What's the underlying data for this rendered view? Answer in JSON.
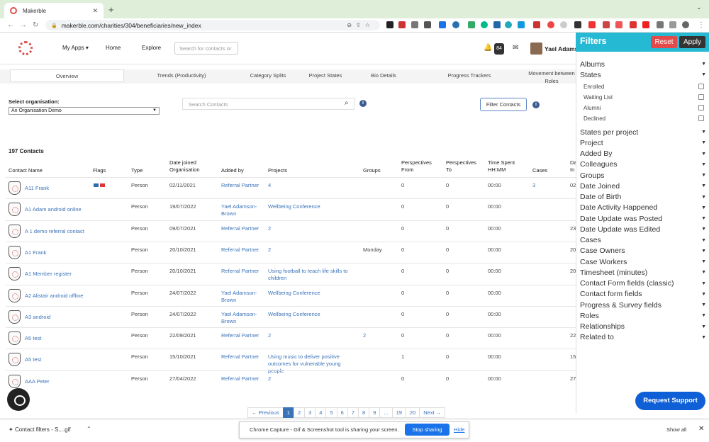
{
  "browser": {
    "tab_title": "Makerble",
    "url": "makerble.com/charities/304/beneficiaries/new_index"
  },
  "header": {
    "my_apps": "My Apps ▾",
    "home": "Home",
    "explore": "Explore",
    "search_placeholder": "Search for contacts or",
    "notifications_count": "84",
    "user_name": "Yael Adams"
  },
  "tabs": [
    "Overview",
    "Trends (Productivity)",
    "Category Splits",
    "Project States",
    "Bio Details",
    "Progress Trackers",
    "Movement between Roles"
  ],
  "org": {
    "label": "Select organisation:",
    "selected": "An Organisation Demo"
  },
  "search": {
    "placeholder": "Search Contacts",
    "filter_button": "Filter Contacts"
  },
  "table": {
    "count_label": "197 Contacts",
    "headers": [
      "Contact Name",
      "Flags",
      "Type",
      "Date joined Organisation",
      "Added by",
      "Projects",
      "Groups",
      "Perspectives From",
      "Perspectives To",
      "Time Spent HH:MM",
      "Cases",
      "Da In"
    ],
    "rows": [
      {
        "name": "A11 Frank",
        "flags": "flags",
        "type": "Person",
        "date": "02/11/2021",
        "added_by": "Referral Partner",
        "projects": "4",
        "groups": "",
        "from": "0",
        "to": "0",
        "time": "00:00",
        "cases": "3",
        "extra": "02"
      },
      {
        "name": "A1 Adam android online",
        "flags": "",
        "type": "Person",
        "date": "19/07/2022",
        "added_by": "Yael Adamson-Brown",
        "projects": "Wellbeing Conference",
        "groups": "",
        "from": "0",
        "to": "0",
        "time": "00:00",
        "cases": "",
        "extra": ""
      },
      {
        "name": "A 1 demo referral contact",
        "flags": "",
        "type": "Person",
        "date": "09/07/2021",
        "added_by": "Referral Partner",
        "projects": "2",
        "groups": "",
        "from": "0",
        "to": "0",
        "time": "00:00",
        "cases": "",
        "extra": "23"
      },
      {
        "name": "A1 Frank",
        "flags": "",
        "type": "Person",
        "date": "20/10/2021",
        "added_by": "Referral Partner",
        "projects": "2",
        "groups": "Monday",
        "from": "0",
        "to": "0",
        "time": "00:00",
        "cases": "",
        "extra": "20"
      },
      {
        "name": "A1 Member register",
        "flags": "",
        "type": "Person",
        "date": "20/10/2021",
        "added_by": "Referral Partner",
        "projects": "Using football to teach life skills to children",
        "groups": "",
        "from": "0",
        "to": "0",
        "time": "00:00",
        "cases": "",
        "extra": "20"
      },
      {
        "name": "A2 Alistair android offline",
        "flags": "",
        "type": "Person",
        "date": "24/07/2022",
        "added_by": "Yael Adamson-Brown",
        "projects": "Wellbeing Conference",
        "groups": "",
        "from": "0",
        "to": "0",
        "time": "00:00",
        "cases": "",
        "extra": ""
      },
      {
        "name": "A3 android",
        "flags": "",
        "type": "Person",
        "date": "24/07/2022",
        "added_by": "Yael Adamson-Brown",
        "projects": "Wellbeing Conference",
        "groups": "",
        "from": "0",
        "to": "0",
        "time": "00:00",
        "cases": "",
        "extra": ""
      },
      {
        "name": "A5 test",
        "flags": "",
        "type": "Person",
        "date": "22/09/2021",
        "added_by": "Referral Partner",
        "projects": "2",
        "groups": "2",
        "from": "0",
        "to": "0",
        "time": "00:00",
        "cases": "",
        "extra": "22"
      },
      {
        "name": "A5 test",
        "flags": "",
        "type": "Person",
        "date": "15/10/2021",
        "added_by": "Referral Partner",
        "projects": "Using music to deliver positive outcomes for vulnerable young people",
        "groups": "",
        "from": "1",
        "to": "0",
        "time": "00:00",
        "cases": "",
        "extra": "15"
      },
      {
        "name": "AAA Peter",
        "flags": "",
        "type": "Person",
        "date": "27/04/2022",
        "added_by": "Referral Partner",
        "projects": "2",
        "groups": "",
        "from": "0",
        "to": "0",
        "time": "00:00",
        "cases": "",
        "extra": "27"
      }
    ]
  },
  "pagination": [
    "← Previous",
    "1",
    "2",
    "3",
    "4",
    "5",
    "6",
    "7",
    "8",
    "9",
    "...",
    "19",
    "20",
    "Next →"
  ],
  "filters": {
    "title": "Filters",
    "reset": "Reset",
    "apply": "Apply",
    "albums": "Albums",
    "states": "States",
    "states_options": [
      "Enrolled",
      "Waiting List",
      "Alumni",
      "Declined"
    ],
    "items": [
      "States per project",
      "Project",
      "Added By",
      "Colleagues",
      "Groups",
      "Date Joined",
      "Date of Birth",
      "Date Activity Happened",
      "Date Update was Posted",
      "Date Update was Edited",
      "Cases",
      "Case Owners",
      "Case Workers",
      "Timesheet (minutes)",
      "Contact Form fields (classic)",
      "Contact form fields",
      "Progress & Survey fields",
      "Roles",
      "Relationships",
      "Related to"
    ]
  },
  "support_button": "Request Support",
  "downloads": {
    "file": "Contact filters - S....gif",
    "share_text": "Chrome Capture - Gif & Screenshot tool is sharing your screen.",
    "stop": "Stop sharing",
    "hide": "Hide",
    "show_all": "Show all"
  }
}
